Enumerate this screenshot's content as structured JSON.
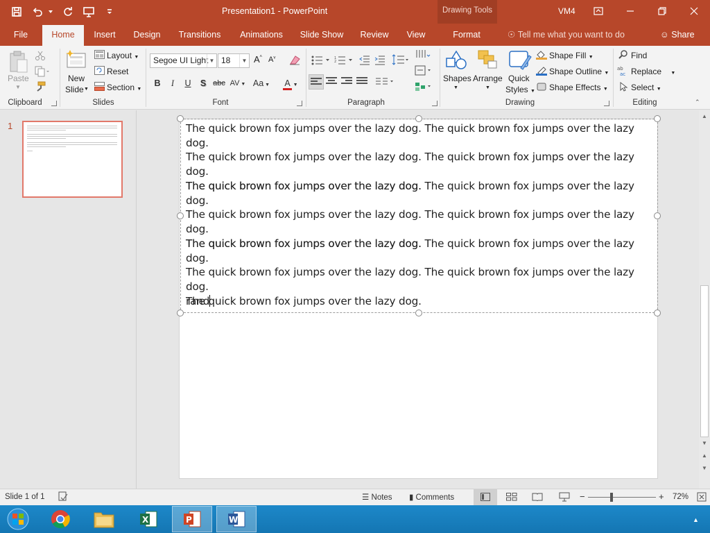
{
  "app": {
    "title": "Presentation1 - PowerPoint",
    "contextual_label": "Drawing Tools",
    "user": "VM4"
  },
  "colors": {
    "accent": "#b7472a",
    "selected_thumb_border": "#e2786a"
  },
  "tabs": [
    "File",
    "Home",
    "Insert",
    "Design",
    "Transitions",
    "Animations",
    "Slide Show",
    "Review",
    "View",
    "Format"
  ],
  "active_tab": "Home",
  "tell_me": "Tell me what you want to do",
  "share": "Share",
  "ribbon": {
    "clipboard": {
      "paste": "Paste",
      "label": "Clipboard"
    },
    "slides": {
      "new_slide_1": "New",
      "new_slide_2": "Slide",
      "layout": "Layout",
      "reset": "Reset",
      "section": "Section",
      "label": "Slides"
    },
    "font": {
      "family": "Segoe UI Light",
      "size": "18",
      "bold": "B",
      "italic": "I",
      "underline": "U",
      "shadow": "S",
      "strike": "abc",
      "spacing": "AV",
      "case": "Aa",
      "color": "A",
      "label": "Font"
    },
    "paragraph": {
      "label": "Paragraph"
    },
    "drawing": {
      "shapes": "Shapes",
      "arrange": "Arrange",
      "quick_styles_1": "Quick",
      "quick_styles_2": "Styles",
      "shape_fill": "Shape Fill",
      "shape_outline": "Shape Outline",
      "shape_effects": "Shape Effects",
      "label": "Drawing"
    },
    "editing": {
      "find": "Find",
      "replace": "Replace",
      "select": "Select",
      "label": "Editing"
    }
  },
  "slides_panel": {
    "number": "1"
  },
  "slide": {
    "paragraphs": [
      [
        "The quick brown fox jumps over the lazy dog. The quick brown fox jumps over the lazy dog.",
        "The quick brown fox jumps over the lazy dog. The quick brown fox jumps over the lazy dog.",
        "The quick brown fox jumps over the lazy dog."
      ],
      [
        "The quick brown fox jumps over the lazy dog. The quick brown fox jumps over the lazy dog.",
        "The quick brown fox jumps over the lazy dog. The quick brown fox jumps over the lazy dog.",
        "The quick brown fox jumps over the lazy dog."
      ],
      [
        "The quick brown fox jumps over the lazy dog. The quick brown fox jumps over the lazy dog.",
        "The quick brown fox jumps over the lazy dog. The quick brown fox jumps over the lazy dog.",
        "The quick brown fox jumps over the lazy dog."
      ]
    ],
    "typing": "rand"
  },
  "status": {
    "slide_info": "Slide 1 of 1",
    "notes": "Notes",
    "comments": "Comments",
    "zoom": "72%",
    "zoom_minus": "−",
    "zoom_plus": "+"
  },
  "taskbar": [
    "start-orb-icon",
    "chrome-icon",
    "file-explorer-icon",
    "excel-icon",
    "powerpoint-icon",
    "word-icon"
  ]
}
